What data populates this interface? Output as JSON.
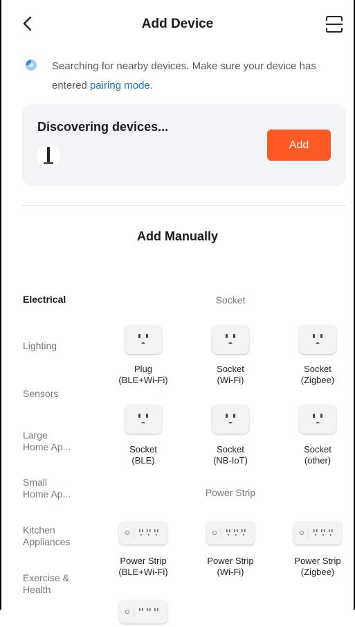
{
  "header": {
    "title": "Add Device"
  },
  "search": {
    "hint_text": "Searching for nearby devices. Make sure your device has entered ",
    "hint_link": "pairing mode",
    "hint_end": "."
  },
  "discovering": {
    "title": "Discovering devices...",
    "add_label": "Add"
  },
  "manual": {
    "title": "Add Manually"
  },
  "categories": [
    {
      "label": "Electrical",
      "active": true
    },
    {
      "label": "Lighting"
    },
    {
      "label": "Sensors"
    },
    {
      "label": "Large\nHome Ap..."
    },
    {
      "label": "Small\nHome Ap..."
    },
    {
      "label": "Kitchen\nAppliances"
    },
    {
      "label": "Exercise &\nHealth"
    }
  ],
  "sections": {
    "socket": {
      "title": "Socket",
      "items": [
        "Plug\n(BLE+Wi-Fi)",
        "Socket\n(Wi-Fi)",
        "Socket\n(Zigbee)",
        "Socket\n(BLE)",
        "Socket\n(NB-IoT)",
        "Socket\n(other)"
      ]
    },
    "power_strip": {
      "title": "Power Strip",
      "items": [
        "Power Strip\n(BLE+Wi-Fi)",
        "Power Strip\n(Wi-Fi)",
        "Power Strip\n(Zigbee)"
      ]
    }
  },
  "colors": {
    "accent": "#ff5a24",
    "link": "#1677c8",
    "card_bg": "#f2f4f7"
  }
}
